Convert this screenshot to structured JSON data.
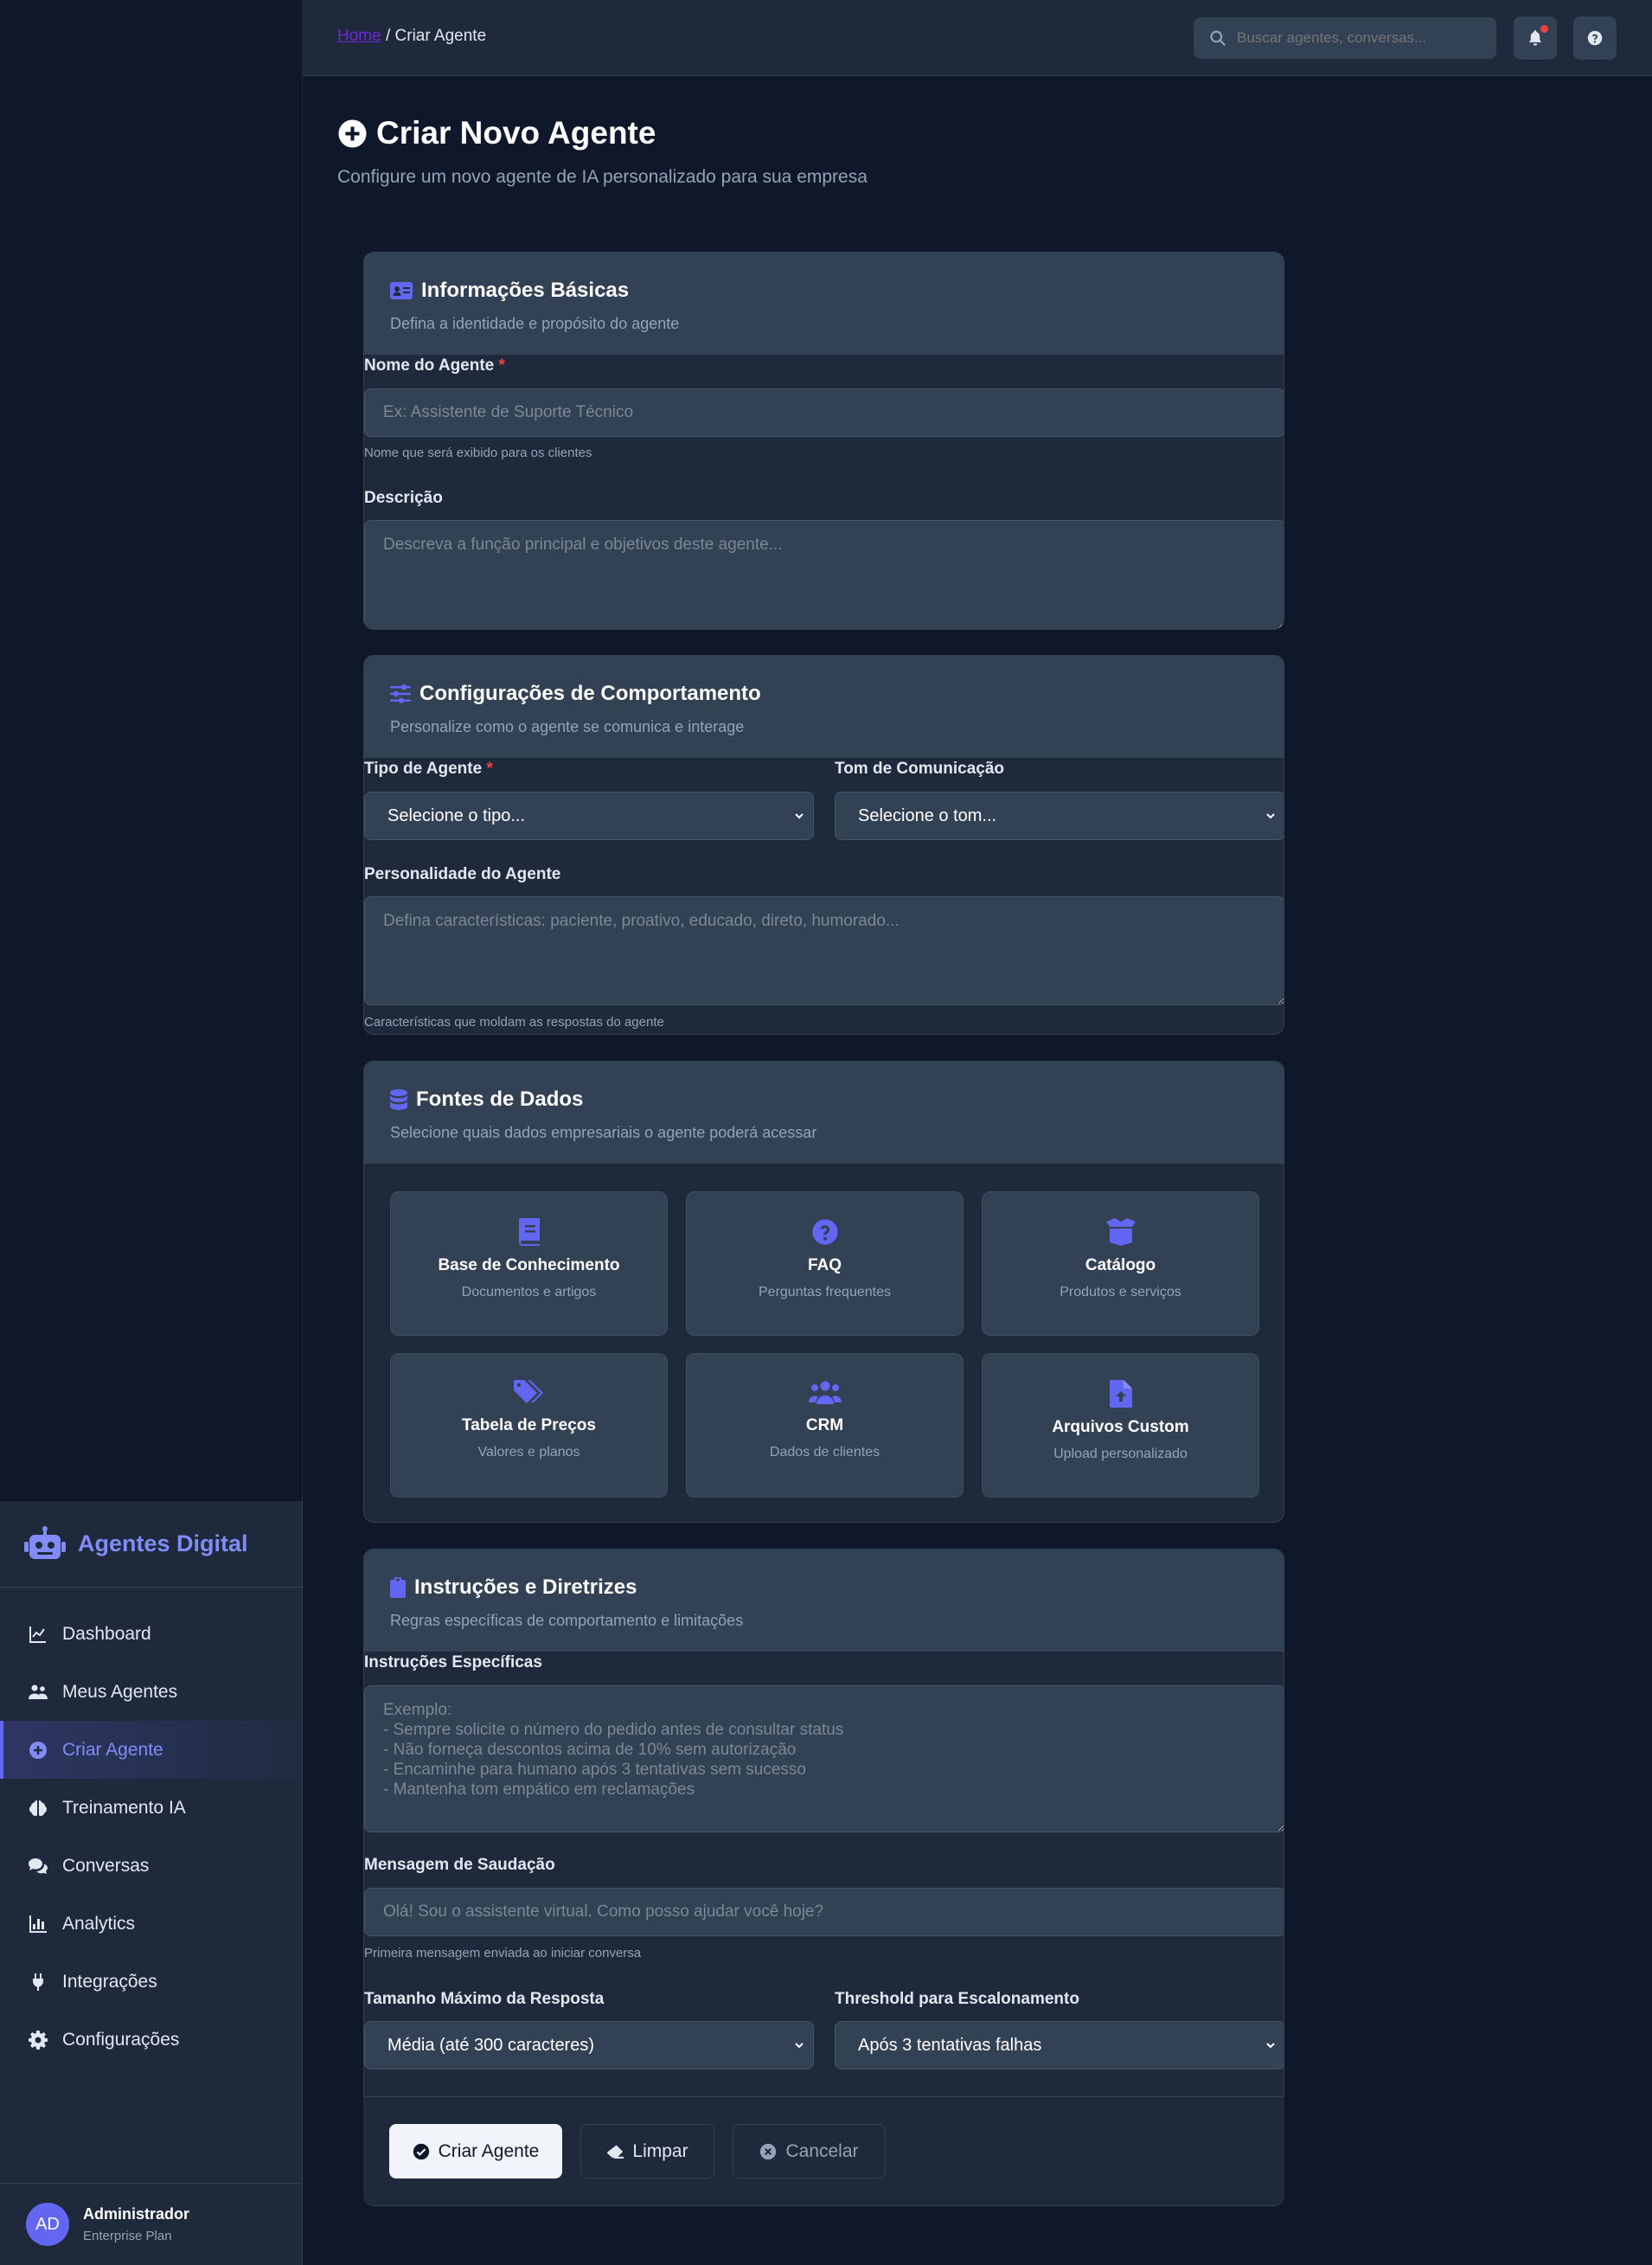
{
  "brand": {
    "name": "Agentes Digital"
  },
  "sidebar": {
    "items": [
      {
        "label": "Dashboard",
        "icon": "chart-line-icon"
      },
      {
        "label": "Meus Agentes",
        "icon": "users-icon"
      },
      {
        "label": "Criar Agente",
        "icon": "plus-circle-icon",
        "active": true
      },
      {
        "label": "Treinamento IA",
        "icon": "brain-icon"
      },
      {
        "label": "Conversas",
        "icon": "comments-icon"
      },
      {
        "label": "Analytics",
        "icon": "chart-bar-icon"
      },
      {
        "label": "Integrações",
        "icon": "plug-icon"
      },
      {
        "label": "Configurações",
        "icon": "gear-icon"
      }
    ],
    "user": {
      "initials": "AD",
      "name": "Administrador",
      "plan": "Enterprise Plan"
    }
  },
  "topbar": {
    "breadcrumb_home": "Home",
    "breadcrumb_sep": " / ",
    "breadcrumb_current": "Criar Agente",
    "search_placeholder": "Buscar agentes, conversas..."
  },
  "page": {
    "title": "Criar Novo Agente",
    "subtitle": "Configure um novo agente de IA personalizado para sua empresa"
  },
  "basic": {
    "title": "Informações Básicas",
    "desc": "Defina a identidade e propósito do agente",
    "name_label": "Nome do Agente",
    "required_mark": "*",
    "name_placeholder": "Ex: Assistente de Suporte Técnico",
    "name_help": "Nome que será exibido para os clientes",
    "desc_label": "Descrição",
    "desc_placeholder": "Descreva a função principal e objetivos deste agente..."
  },
  "behavior": {
    "title": "Configurações de Comportamento",
    "desc": "Personalize como o agente se comunica e interage",
    "type_label": "Tipo de Agente",
    "type_value": "Selecione o tipo...",
    "tone_label": "Tom de Comunicação",
    "tone_value": "Selecione o tom...",
    "personality_label": "Personalidade do Agente",
    "personality_placeholder": "Defina características: paciente, proativo, educado, direto, humorado...",
    "personality_help": "Características que moldam as respostas do agente"
  },
  "sources": {
    "title": "Fontes de Dados",
    "desc": "Selecione quais dados empresariais o agente poderá acessar",
    "items": [
      {
        "name": "Base de Conhecimento",
        "desc": "Documentos e artigos",
        "icon": "book-icon"
      },
      {
        "name": "FAQ",
        "desc": "Perguntas frequentes",
        "icon": "question-circle-icon"
      },
      {
        "name": "Catálogo",
        "desc": "Produtos e serviços",
        "icon": "box-open-icon"
      },
      {
        "name": "Tabela de Preços",
        "desc": "Valores e planos",
        "icon": "tags-icon"
      },
      {
        "name": "CRM",
        "desc": "Dados de clientes",
        "icon": "users-icon"
      },
      {
        "name": "Arquivos Custom",
        "desc": "Upload personalizado",
        "icon": "file-upload-icon"
      }
    ]
  },
  "instructions": {
    "title": "Instruções e Diretrizes",
    "desc": "Regras específicas de comportamento e limitações",
    "specific_label": "Instruções Específicas",
    "specific_placeholder": "Exemplo:\n- Sempre solicite o número do pedido antes de consultar status\n- Não forneça descontos acima de 10% sem autorização\n- Encaminhe para humano após 3 tentativas sem sucesso\n- Mantenha tom empático em reclamações",
    "greeting_label": "Mensagem de Saudação",
    "greeting_placeholder": "Olá! Sou o assistente virtual. Como posso ajudar você hoje?",
    "greeting_help": "Primeira mensagem enviada ao iniciar conversa",
    "maxlen_label": "Tamanho Máximo da Resposta",
    "maxlen_value": "Média (até 300 caracteres)",
    "threshold_label": "Threshold para Escalonamento",
    "threshold_value": "Após 3 tentativas falhas"
  },
  "actions": {
    "create": "Criar Agente",
    "clear": "Limpar",
    "cancel": "Cancelar"
  },
  "colors": {
    "accent": "#6366f1",
    "accent_light": "#818cf8",
    "danger": "#ef4444"
  }
}
